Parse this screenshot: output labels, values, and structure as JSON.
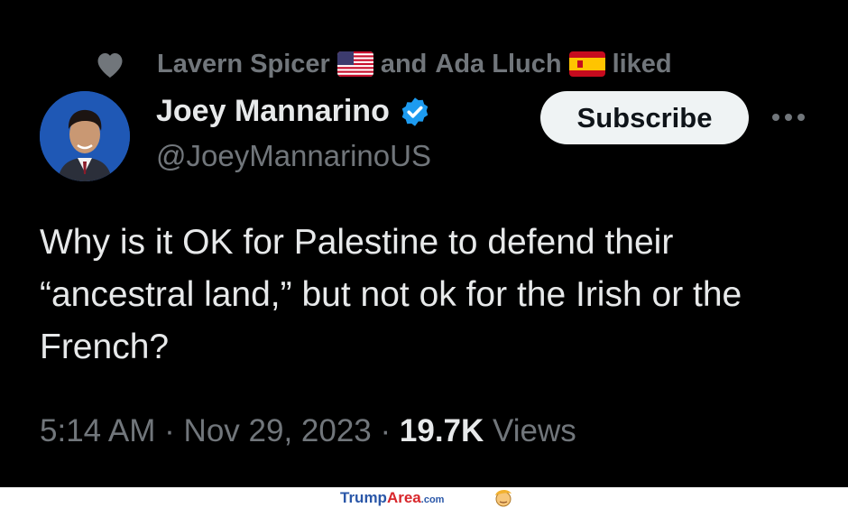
{
  "social_context": {
    "user1": "Lavern Spicer",
    "connector": "and",
    "user2": "Ada Lluch",
    "action": "liked"
  },
  "author": {
    "name": "Joey Mannarino",
    "handle": "@JoeyMannarinoUS"
  },
  "subscribe_label": "Subscribe",
  "tweet": {
    "text": "Why is it OK for Palestine to defend their “ancestral land,” but not ok for the Irish or the French?"
  },
  "meta": {
    "time": "5:14 AM",
    "separator": "·",
    "date": "Nov 29, 2023",
    "views_count": "19.7K",
    "views_label": "Views"
  },
  "footer": {
    "brand_trump": "Trump",
    "brand_area": "Area",
    "brand_tld": ".com"
  },
  "colors": {
    "background": "#000000",
    "text": "#e7e9ea",
    "muted": "#71767b",
    "verified": "#1d9bf0"
  }
}
